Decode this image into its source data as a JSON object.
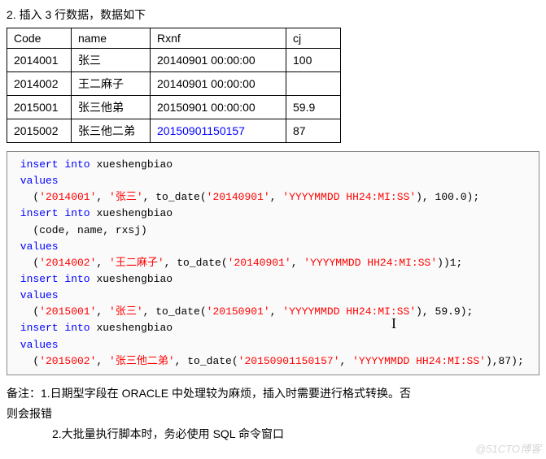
{
  "heading": "2.  插入 3 行数据，数据如下",
  "table": {
    "headers": [
      "Code",
      "name",
      "Rxnf",
      "cj"
    ],
    "rows": [
      {
        "code": "2014001",
        "name": "张三",
        "rxnf": "20140901 00:00:00",
        "cj": "100"
      },
      {
        "code": "2014002",
        "name": "王二麻子",
        "rxnf": "20140901 00:00:00",
        "cj": ""
      },
      {
        "code": "2015001",
        "name": "张三他弟",
        "rxnf": "20150901 00:00:00",
        "cj": "59.9"
      },
      {
        "code": "2015002",
        "name": "张三他二弟",
        "rxnf": "20150901150157",
        "cj": "87",
        "rxnf_highlight": true
      }
    ]
  },
  "sql": {
    "kw_insert_into": "insert into",
    "kw_values": "values",
    "tbl": "xueshengbiao",
    "fn_to_date": "to_date",
    "fmt": "'YYYYMMDD HH24:MI:SS'",
    "stmt1_vals": {
      "code": "'2014001'",
      "name": "'张三'",
      "date": "'20140901'",
      "cj": "100.0"
    },
    "stmt2_cols": "(code, name, rxsj)",
    "stmt2_vals": {
      "code": "'2014002'",
      "name": "'王二麻子'",
      "date": "'20140901'",
      "tail": ")1;"
    },
    "stmt3_vals": {
      "code": "'2015001'",
      "name": "'张三'",
      "date": "'20150901'",
      "cj": "59.9"
    },
    "stmt4_vals": {
      "code": "'2015002'",
      "name": "'张三他二弟'",
      "date": "'20150901150157'",
      "cj": "87"
    }
  },
  "notes": {
    "prefix": "备注：",
    "line1a": "1.日期型字段在 ORACLE 中处理较为麻烦，插入时需要进行格式转换。否",
    "line1b": "则会报错",
    "line2": "2.大批量执行脚本时，务必使用 SQL 命令窗口"
  },
  "watermark": "@51CTO博客"
}
